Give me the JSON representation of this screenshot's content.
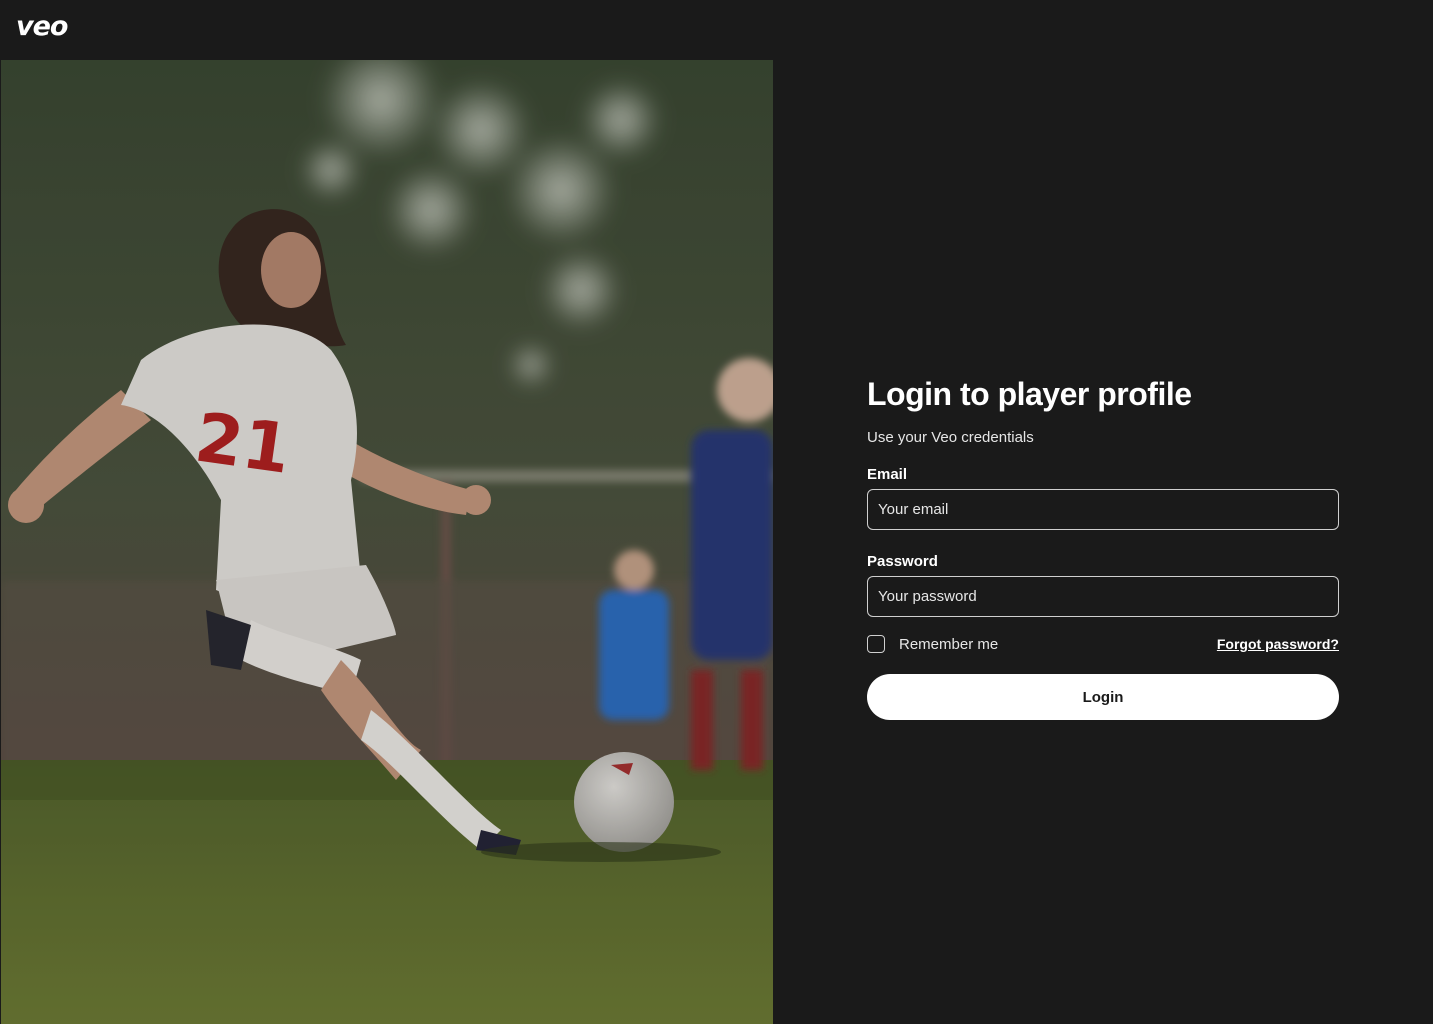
{
  "header": {
    "logo_text": "veo"
  },
  "hero": {
    "image_name": "soccer-player-kicking-ball",
    "jersey_number": "21"
  },
  "login": {
    "title": "Login to player profile",
    "subtitle": "Use your Veo credentials",
    "email_label": "Email",
    "email_placeholder": "Your email",
    "email_value": "",
    "password_label": "Password",
    "password_placeholder": "Your password",
    "password_value": "",
    "remember_label": "Remember me",
    "remember_checked": false,
    "forgot_label": "Forgot password?",
    "submit_label": "Login"
  },
  "colors": {
    "background": "#1a1a1a",
    "text": "#ffffff",
    "button_bg": "#ffffff",
    "button_text": "#1a1a1a",
    "input_border": "#cfcfcf"
  }
}
